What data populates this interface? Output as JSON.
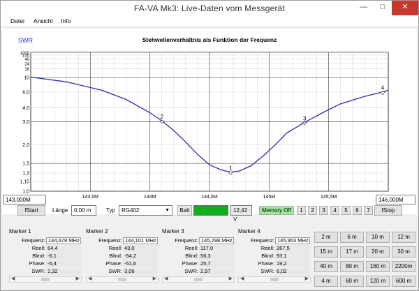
{
  "window": {
    "title": "FA-VA Mk3:     Live-Daten vom Messgerät",
    "min_icon": "minimize-icon",
    "max_icon": "maximize-icon",
    "close_icon": "close-icon"
  },
  "menu": {
    "items": [
      "Datei",
      "Ansicht",
      "Info"
    ]
  },
  "plot": {
    "y_unit_label": "SWR",
    "heading": "Stehwellenverhältnis als Funktion der Frequenz",
    "start_freq": "143,000M",
    "stop_freq": "146,000M"
  },
  "chart_data": {
    "type": "line",
    "title": "Stehwellenverhältnis als Funktion der Frequenz",
    "ylabel": "SWR",
    "xlabel": "",
    "yscale": "log (1/(SWR) style)",
    "x_ticks": [
      "143,5M",
      "144M",
      "144,5M",
      "145M",
      "145,5M"
    ],
    "y_ticks": [
      "1000",
      "100",
      "40",
      "24",
      "16",
      "10",
      "6,0",
      "4,0",
      "3,0",
      "2,0",
      "1,5",
      "1,3",
      "1,15",
      "1,0"
    ],
    "xlim": [
      143.0,
      146.0
    ],
    "ylim": [
      1.0,
      1000
    ],
    "series": [
      {
        "color": "#2a2ab4",
        "x": [
          143.0,
          143.3,
          143.6,
          143.8,
          144.0,
          144.1,
          144.2,
          144.3,
          144.4,
          144.5,
          144.6,
          144.678,
          144.75,
          144.85,
          144.95,
          145.05,
          145.15,
          145.298,
          145.45,
          145.6,
          145.8,
          145.953,
          146.0
        ],
        "y": [
          10.2,
          8.4,
          6.3,
          4.9,
          3.6,
          3.06,
          2.55,
          2.1,
          1.72,
          1.47,
          1.36,
          1.32,
          1.34,
          1.45,
          1.68,
          2.0,
          2.45,
          2.97,
          3.6,
          4.4,
          5.3,
          6.02,
          6.3
        ]
      }
    ],
    "markers": [
      {
        "label": "1",
        "x": 144.678,
        "y": 1.32
      },
      {
        "label": "2",
        "x": 144.101,
        "y": 3.06
      },
      {
        "label": "3",
        "x": 145.298,
        "y": 2.97
      },
      {
        "label": "4",
        "x": 145.953,
        "y": 6.02
      }
    ],
    "grid": true
  },
  "controls": {
    "fstart_label": "fStart",
    "laenge_label": "Länge",
    "laenge_value": "0,00 m",
    "typ_label": "Typ",
    "typ_value": "RG402",
    "batt_label": "Batt",
    "batt_color": "#0fae1c",
    "voltage": "12,42 V",
    "memory_off": "Memory Off",
    "memory_color": "#9ee89e",
    "mem_buttons": [
      "1",
      "2",
      "3",
      "4",
      "5",
      "6",
      "7"
    ],
    "fstop_label": "fStop",
    "dropdown_icon": "chevron-down-icon"
  },
  "markers": [
    {
      "title": "Marker 1",
      "freq": "144,678 MHz",
      "reell": "64,4",
      "blind": "-6,1",
      "phase": "-5,4",
      "swr": "1,32"
    },
    {
      "title": "Marker 2",
      "freq": "144,101 MHz",
      "reell": "43,0",
      "blind": "-54,2",
      "phase": "-51,6",
      "swr": "3,06"
    },
    {
      "title": "Marker 3",
      "freq": "145,298 MHz",
      "reell": "117,0",
      "blind": "56,3",
      "phase": "25,7",
      "swr": "2,97"
    },
    {
      "title": "Marker 4",
      "freq": "145,953 MHz",
      "reell": "267,5",
      "blind": "93,1",
      "phase": "19,2",
      "swr": "6,02"
    }
  ],
  "marker_field_labels": {
    "freq": "Frequenz:",
    "reell": "Reell:",
    "blind": "Blind:",
    "phase": "Phase:",
    "swr": "SWR:"
  },
  "span_buttons": [
    [
      "2 m",
      "6 m",
      "10 m",
      "12 m"
    ],
    [
      "15 m",
      "17 m",
      "20 m",
      "30 m"
    ],
    [
      "40 m",
      "80 m",
      "160 m",
      "2200m"
    ],
    [
      "4 m",
      "60 m",
      "120 m",
      "600 m"
    ]
  ]
}
